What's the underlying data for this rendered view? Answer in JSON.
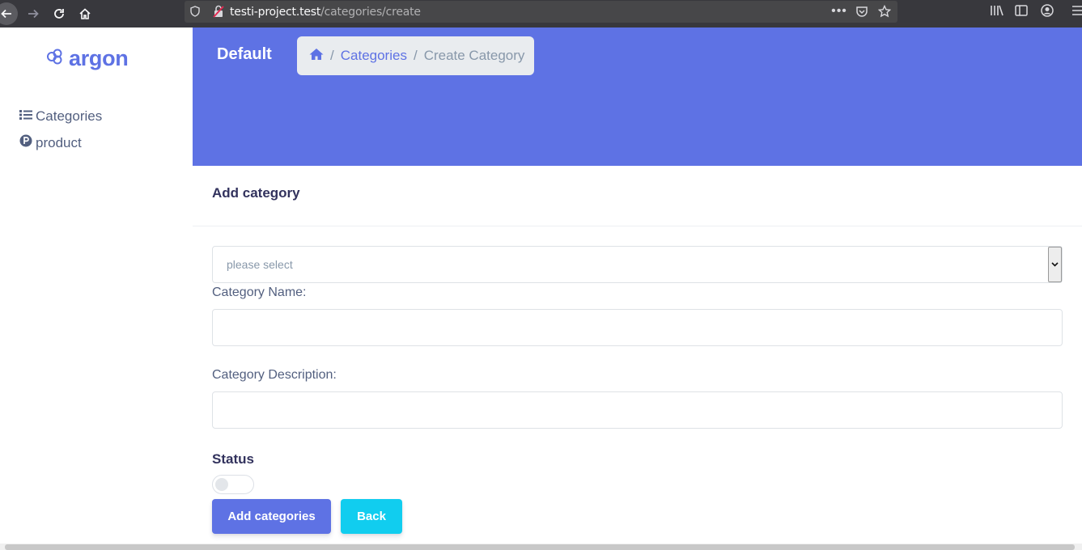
{
  "browser": {
    "url_host": "testi-project.test",
    "url_path": "/categories/create",
    "icons": [
      "back-icon",
      "forward-icon",
      "reload-icon",
      "home-icon",
      "tracking-shield-icon",
      "insecure-lock-icon",
      "more-icon",
      "pocket-icon",
      "bookmark-star-icon",
      "library-icon",
      "sidebar-icon",
      "account-icon",
      "menu-icon"
    ]
  },
  "sidebar": {
    "brand": "argon",
    "items": [
      {
        "label": "Categories",
        "icon": "list-icon"
      },
      {
        "label": "product",
        "icon": "p-circle-icon"
      }
    ]
  },
  "header": {
    "title": "Default",
    "breadcrumb": {
      "home_icon": "home-icon",
      "separator": "/",
      "link": "Categories",
      "active": "Create Category"
    }
  },
  "card": {
    "title": "Add category",
    "select": {
      "placeholder": "please select"
    },
    "fields": [
      {
        "label": "Category Name:",
        "value": ""
      },
      {
        "label": "Category Description:",
        "value": ""
      }
    ],
    "status": {
      "label": "Status",
      "checked": false
    },
    "buttons": {
      "submit": "Add categories",
      "back": "Back"
    }
  },
  "colors": {
    "primary": "#5e72e4",
    "info": "#11cdef",
    "heading": "#32325d",
    "text": "#525f7f",
    "muted": "#8898aa"
  }
}
